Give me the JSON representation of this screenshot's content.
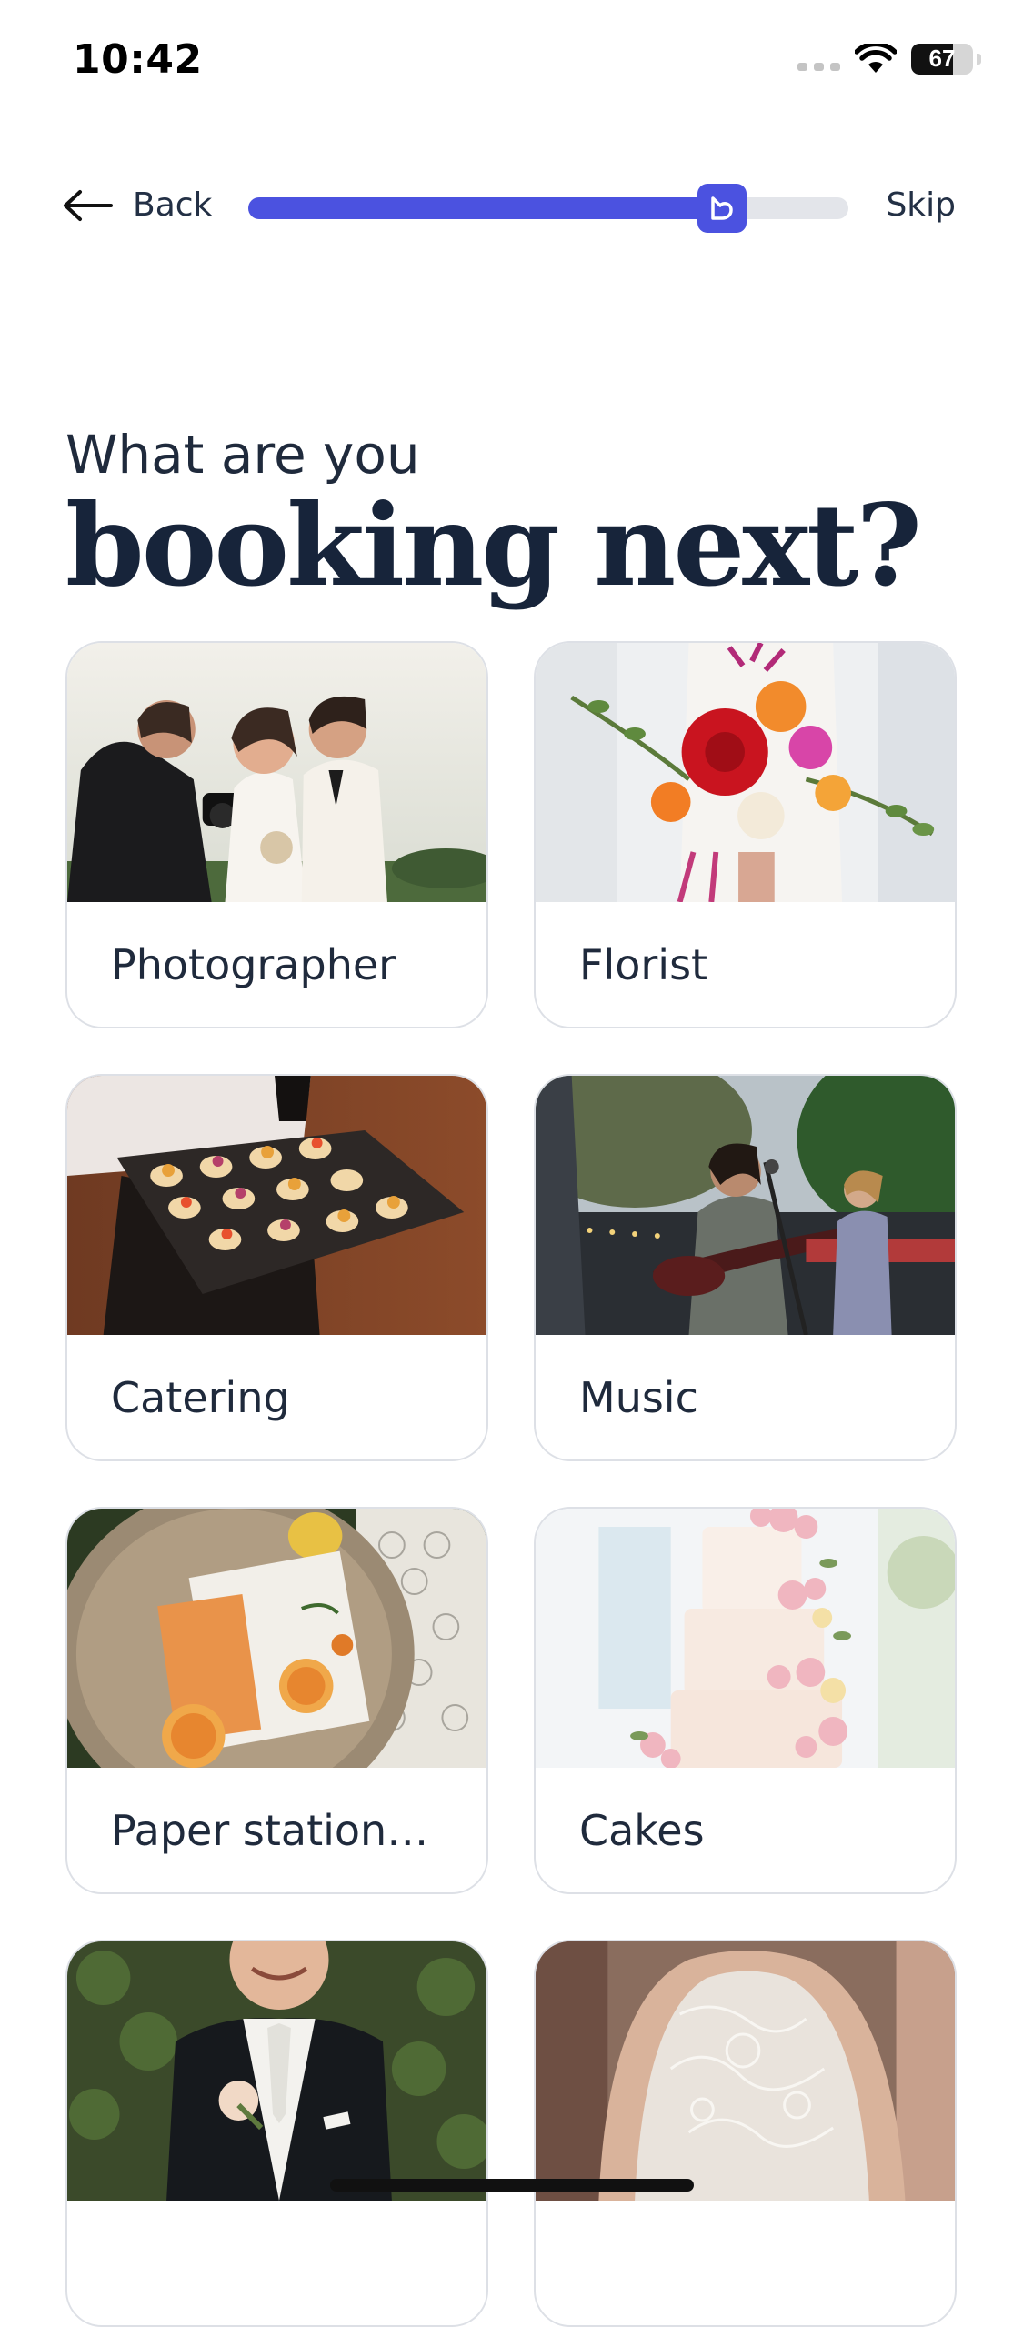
{
  "status_bar": {
    "time": "10:42",
    "battery": "67",
    "battery_level": 0.67
  },
  "nav": {
    "back_label": "Back",
    "skip_label": "Skip",
    "progress": 0.79
  },
  "heading": {
    "subtitle": "What are you",
    "title": "booking next?"
  },
  "categories": [
    {
      "label": "Photographer"
    },
    {
      "label": "Florist"
    },
    {
      "label": "Catering"
    },
    {
      "label": "Music"
    },
    {
      "label": "Paper statione..."
    },
    {
      "label": "Cakes"
    },
    {
      "label": ""
    },
    {
      "label": ""
    }
  ],
  "colors": {
    "accent": "#4b52e0",
    "text": "#1f2a3c",
    "track": "#e3e5ea"
  }
}
